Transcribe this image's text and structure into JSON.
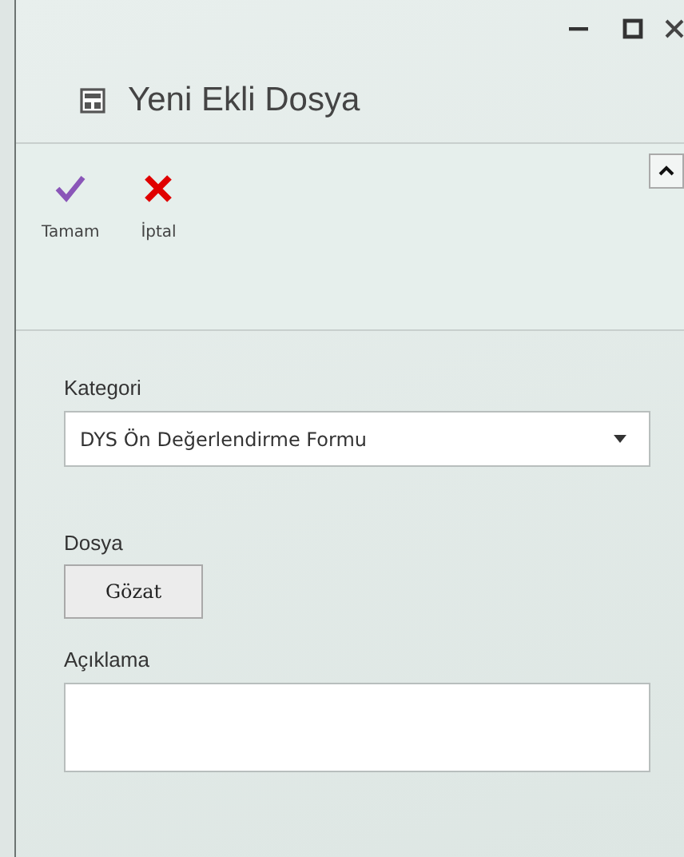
{
  "window": {
    "title": "Yeni Ekli Dosya"
  },
  "toolbar": {
    "buttons": [
      {
        "label": "Tamam",
        "kind": "ok"
      },
      {
        "label": "İptal",
        "kind": "cancel"
      }
    ]
  },
  "form": {
    "category": {
      "label": "Kategori",
      "value": "DYS Ön Değerlendirme Formu"
    },
    "file": {
      "label": "Dosya",
      "button": "Gözat"
    },
    "description": {
      "label": "Açıklama"
    }
  }
}
